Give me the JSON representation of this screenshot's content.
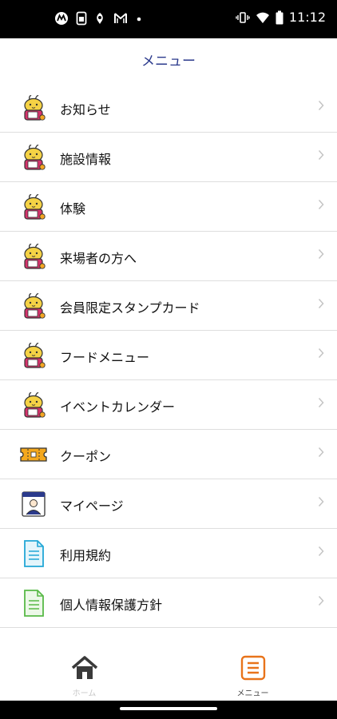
{
  "status_bar": {
    "time": "11:12",
    "left_icons": [
      "motorola-icon",
      "sim-icon",
      "notification-icon",
      "m-app-icon",
      "dot-icon"
    ],
    "right_icons": [
      "vibrate-icon",
      "wifi-icon",
      "battery-icon"
    ]
  },
  "header": {
    "title": "メニュー"
  },
  "menu": {
    "items": [
      {
        "label": "お知らせ",
        "icon": "mascot-icon"
      },
      {
        "label": "施設情報",
        "icon": "mascot-icon"
      },
      {
        "label": "体験",
        "icon": "mascot-icon"
      },
      {
        "label": "来場者の方へ",
        "icon": "mascot-icon"
      },
      {
        "label": "会員限定スタンプカード",
        "icon": "mascot-icon"
      },
      {
        "label": "フードメニュー",
        "icon": "mascot-icon"
      },
      {
        "label": "イベントカレンダー",
        "icon": "mascot-icon"
      },
      {
        "label": "クーポン",
        "icon": "coupon-ticket-icon"
      },
      {
        "label": "マイページ",
        "icon": "profile-card-icon"
      },
      {
        "label": "利用規約",
        "icon": "document-icon"
      },
      {
        "label": "個人情報保護方針",
        "icon": "document-icon"
      }
    ]
  },
  "tabbar": {
    "home_label": "ホーム",
    "menu_label": "メニュー"
  },
  "colors": {
    "accent": "#2b3a8c",
    "mascot_yellow": "#f5d245",
    "mascot_pink": "#d6336c",
    "coupon": "#f4a81d",
    "document_blue": "#22a7d6",
    "document_green": "#58b947",
    "tab_active": "#e8731a"
  }
}
